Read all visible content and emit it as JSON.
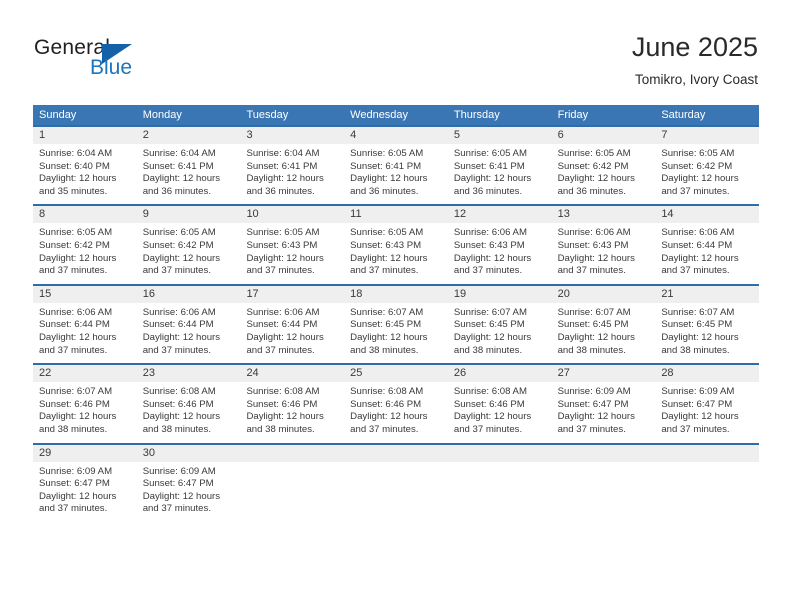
{
  "brand": {
    "name_part1": "General",
    "name_part2": "Blue",
    "flag_icon": "blue-triangle-flag-icon"
  },
  "header": {
    "title": "June 2025",
    "location": "Tomikro, Ivory Coast"
  },
  "colors": {
    "header_blue": "#3b76b4",
    "row_divider_blue": "#2f6cab",
    "daynum_band": "#efefef",
    "brand_blue": "#1c75bc",
    "text": "#3a3a3a"
  },
  "weekdays": [
    "Sunday",
    "Monday",
    "Tuesday",
    "Wednesday",
    "Thursday",
    "Friday",
    "Saturday"
  ],
  "weeks": [
    {
      "days": [
        {
          "date": "1",
          "sunrise": "Sunrise: 6:04 AM",
          "sunset": "Sunset: 6:40 PM",
          "daylight1": "Daylight: 12 hours",
          "daylight2": "and 35 minutes."
        },
        {
          "date": "2",
          "sunrise": "Sunrise: 6:04 AM",
          "sunset": "Sunset: 6:41 PM",
          "daylight1": "Daylight: 12 hours",
          "daylight2": "and 36 minutes."
        },
        {
          "date": "3",
          "sunrise": "Sunrise: 6:04 AM",
          "sunset": "Sunset: 6:41 PM",
          "daylight1": "Daylight: 12 hours",
          "daylight2": "and 36 minutes."
        },
        {
          "date": "4",
          "sunrise": "Sunrise: 6:05 AM",
          "sunset": "Sunset: 6:41 PM",
          "daylight1": "Daylight: 12 hours",
          "daylight2": "and 36 minutes."
        },
        {
          "date": "5",
          "sunrise": "Sunrise: 6:05 AM",
          "sunset": "Sunset: 6:41 PM",
          "daylight1": "Daylight: 12 hours",
          "daylight2": "and 36 minutes."
        },
        {
          "date": "6",
          "sunrise": "Sunrise: 6:05 AM",
          "sunset": "Sunset: 6:42 PM",
          "daylight1": "Daylight: 12 hours",
          "daylight2": "and 36 minutes."
        },
        {
          "date": "7",
          "sunrise": "Sunrise: 6:05 AM",
          "sunset": "Sunset: 6:42 PM",
          "daylight1": "Daylight: 12 hours",
          "daylight2": "and 37 minutes."
        }
      ]
    },
    {
      "days": [
        {
          "date": "8",
          "sunrise": "Sunrise: 6:05 AM",
          "sunset": "Sunset: 6:42 PM",
          "daylight1": "Daylight: 12 hours",
          "daylight2": "and 37 minutes."
        },
        {
          "date": "9",
          "sunrise": "Sunrise: 6:05 AM",
          "sunset": "Sunset: 6:42 PM",
          "daylight1": "Daylight: 12 hours",
          "daylight2": "and 37 minutes."
        },
        {
          "date": "10",
          "sunrise": "Sunrise: 6:05 AM",
          "sunset": "Sunset: 6:43 PM",
          "daylight1": "Daylight: 12 hours",
          "daylight2": "and 37 minutes."
        },
        {
          "date": "11",
          "sunrise": "Sunrise: 6:05 AM",
          "sunset": "Sunset: 6:43 PM",
          "daylight1": "Daylight: 12 hours",
          "daylight2": "and 37 minutes."
        },
        {
          "date": "12",
          "sunrise": "Sunrise: 6:06 AM",
          "sunset": "Sunset: 6:43 PM",
          "daylight1": "Daylight: 12 hours",
          "daylight2": "and 37 minutes."
        },
        {
          "date": "13",
          "sunrise": "Sunrise: 6:06 AM",
          "sunset": "Sunset: 6:43 PM",
          "daylight1": "Daylight: 12 hours",
          "daylight2": "and 37 minutes."
        },
        {
          "date": "14",
          "sunrise": "Sunrise: 6:06 AM",
          "sunset": "Sunset: 6:44 PM",
          "daylight1": "Daylight: 12 hours",
          "daylight2": "and 37 minutes."
        }
      ]
    },
    {
      "days": [
        {
          "date": "15",
          "sunrise": "Sunrise: 6:06 AM",
          "sunset": "Sunset: 6:44 PM",
          "daylight1": "Daylight: 12 hours",
          "daylight2": "and 37 minutes."
        },
        {
          "date": "16",
          "sunrise": "Sunrise: 6:06 AM",
          "sunset": "Sunset: 6:44 PM",
          "daylight1": "Daylight: 12 hours",
          "daylight2": "and 37 minutes."
        },
        {
          "date": "17",
          "sunrise": "Sunrise: 6:06 AM",
          "sunset": "Sunset: 6:44 PM",
          "daylight1": "Daylight: 12 hours",
          "daylight2": "and 37 minutes."
        },
        {
          "date": "18",
          "sunrise": "Sunrise: 6:07 AM",
          "sunset": "Sunset: 6:45 PM",
          "daylight1": "Daylight: 12 hours",
          "daylight2": "and 38 minutes."
        },
        {
          "date": "19",
          "sunrise": "Sunrise: 6:07 AM",
          "sunset": "Sunset: 6:45 PM",
          "daylight1": "Daylight: 12 hours",
          "daylight2": "and 38 minutes."
        },
        {
          "date": "20",
          "sunrise": "Sunrise: 6:07 AM",
          "sunset": "Sunset: 6:45 PM",
          "daylight1": "Daylight: 12 hours",
          "daylight2": "and 38 minutes."
        },
        {
          "date": "21",
          "sunrise": "Sunrise: 6:07 AM",
          "sunset": "Sunset: 6:45 PM",
          "daylight1": "Daylight: 12 hours",
          "daylight2": "and 38 minutes."
        }
      ]
    },
    {
      "days": [
        {
          "date": "22",
          "sunrise": "Sunrise: 6:07 AM",
          "sunset": "Sunset: 6:46 PM",
          "daylight1": "Daylight: 12 hours",
          "daylight2": "and 38 minutes."
        },
        {
          "date": "23",
          "sunrise": "Sunrise: 6:08 AM",
          "sunset": "Sunset: 6:46 PM",
          "daylight1": "Daylight: 12 hours",
          "daylight2": "and 38 minutes."
        },
        {
          "date": "24",
          "sunrise": "Sunrise: 6:08 AM",
          "sunset": "Sunset: 6:46 PM",
          "daylight1": "Daylight: 12 hours",
          "daylight2": "and 38 minutes."
        },
        {
          "date": "25",
          "sunrise": "Sunrise: 6:08 AM",
          "sunset": "Sunset: 6:46 PM",
          "daylight1": "Daylight: 12 hours",
          "daylight2": "and 37 minutes."
        },
        {
          "date": "26",
          "sunrise": "Sunrise: 6:08 AM",
          "sunset": "Sunset: 6:46 PM",
          "daylight1": "Daylight: 12 hours",
          "daylight2": "and 37 minutes."
        },
        {
          "date": "27",
          "sunrise": "Sunrise: 6:09 AM",
          "sunset": "Sunset: 6:47 PM",
          "daylight1": "Daylight: 12 hours",
          "daylight2": "and 37 minutes."
        },
        {
          "date": "28",
          "sunrise": "Sunrise: 6:09 AM",
          "sunset": "Sunset: 6:47 PM",
          "daylight1": "Daylight: 12 hours",
          "daylight2": "and 37 minutes."
        }
      ]
    },
    {
      "days": [
        {
          "date": "29",
          "sunrise": "Sunrise: 6:09 AM",
          "sunset": "Sunset: 6:47 PM",
          "daylight1": "Daylight: 12 hours",
          "daylight2": "and 37 minutes."
        },
        {
          "date": "30",
          "sunrise": "Sunrise: 6:09 AM",
          "sunset": "Sunset: 6:47 PM",
          "daylight1": "Daylight: 12 hours",
          "daylight2": "and 37 minutes."
        },
        {
          "date": "",
          "sunrise": "",
          "sunset": "",
          "daylight1": "",
          "daylight2": ""
        },
        {
          "date": "",
          "sunrise": "",
          "sunset": "",
          "daylight1": "",
          "daylight2": ""
        },
        {
          "date": "",
          "sunrise": "",
          "sunset": "",
          "daylight1": "",
          "daylight2": ""
        },
        {
          "date": "",
          "sunrise": "",
          "sunset": "",
          "daylight1": "",
          "daylight2": ""
        },
        {
          "date": "",
          "sunrise": "",
          "sunset": "",
          "daylight1": "",
          "daylight2": ""
        }
      ]
    }
  ]
}
